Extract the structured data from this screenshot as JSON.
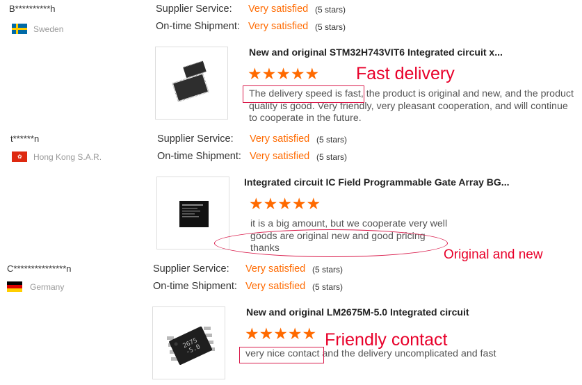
{
  "reviews": [
    {
      "buyer": "B**********h",
      "country": "Sweden",
      "supplier_service_label": "Supplier Service:",
      "supplier_service_value": "Very satisfied",
      "supplier_service_stars": "(5 stars)",
      "shipment_label": "On-time Shipment:",
      "shipment_value": "Very satisfied",
      "shipment_stars": "(5 stars)",
      "product_title": "New and original STM32H743VIT6 Integrated circuit x...",
      "rating": "★★★★★",
      "review_highlight": "The delivery speed is fast,",
      "review_rest": " the product is original and new, and the product",
      "review_line2": "quality is good. Very friendly, very pleasant cooperation, and will continue",
      "review_line3": "to cooperate in the future.",
      "annotation": "Fast delivery"
    },
    {
      "buyer": "t******n",
      "country": "Hong Kong S.A.R.",
      "supplier_service_label": "Supplier Service:",
      "supplier_service_value": "Very satisfied",
      "supplier_service_stars": "(5 stars)",
      "shipment_label": "On-time Shipment:",
      "shipment_value": "Very satisfied",
      "shipment_stars": "(5 stars)",
      "product_title": "Integrated circuit IC Field Programmable Gate Array BG...",
      "rating": "★★★★★",
      "review_line1": "it is a big amount, but we cooperate very well",
      "review_line2": "goods are original new and good pricing",
      "review_line3": "thanks",
      "annotation": "Original and new"
    },
    {
      "buyer": "C***************n",
      "country": "Germany",
      "supplier_service_label": "Supplier Service:",
      "supplier_service_value": "Very satisfied",
      "supplier_service_stars": "(5 stars)",
      "shipment_label": "On-time Shipment:",
      "shipment_value": "Very satisfied",
      "shipment_stars": "(5 stars)",
      "product_title": "New and original LM2675M-5.0 Integrated circuit",
      "rating": "★★★★★",
      "review_highlight": "very nice contact",
      "review_rest": " and the delivery uncomplicated and fast",
      "annotation": "Friendly contact",
      "chip_marking": "2675\n-5.0"
    }
  ],
  "colors": {
    "accent": "#ff6a00",
    "annotation": "#e8002a",
    "highlight_border": "#d91a4a"
  }
}
